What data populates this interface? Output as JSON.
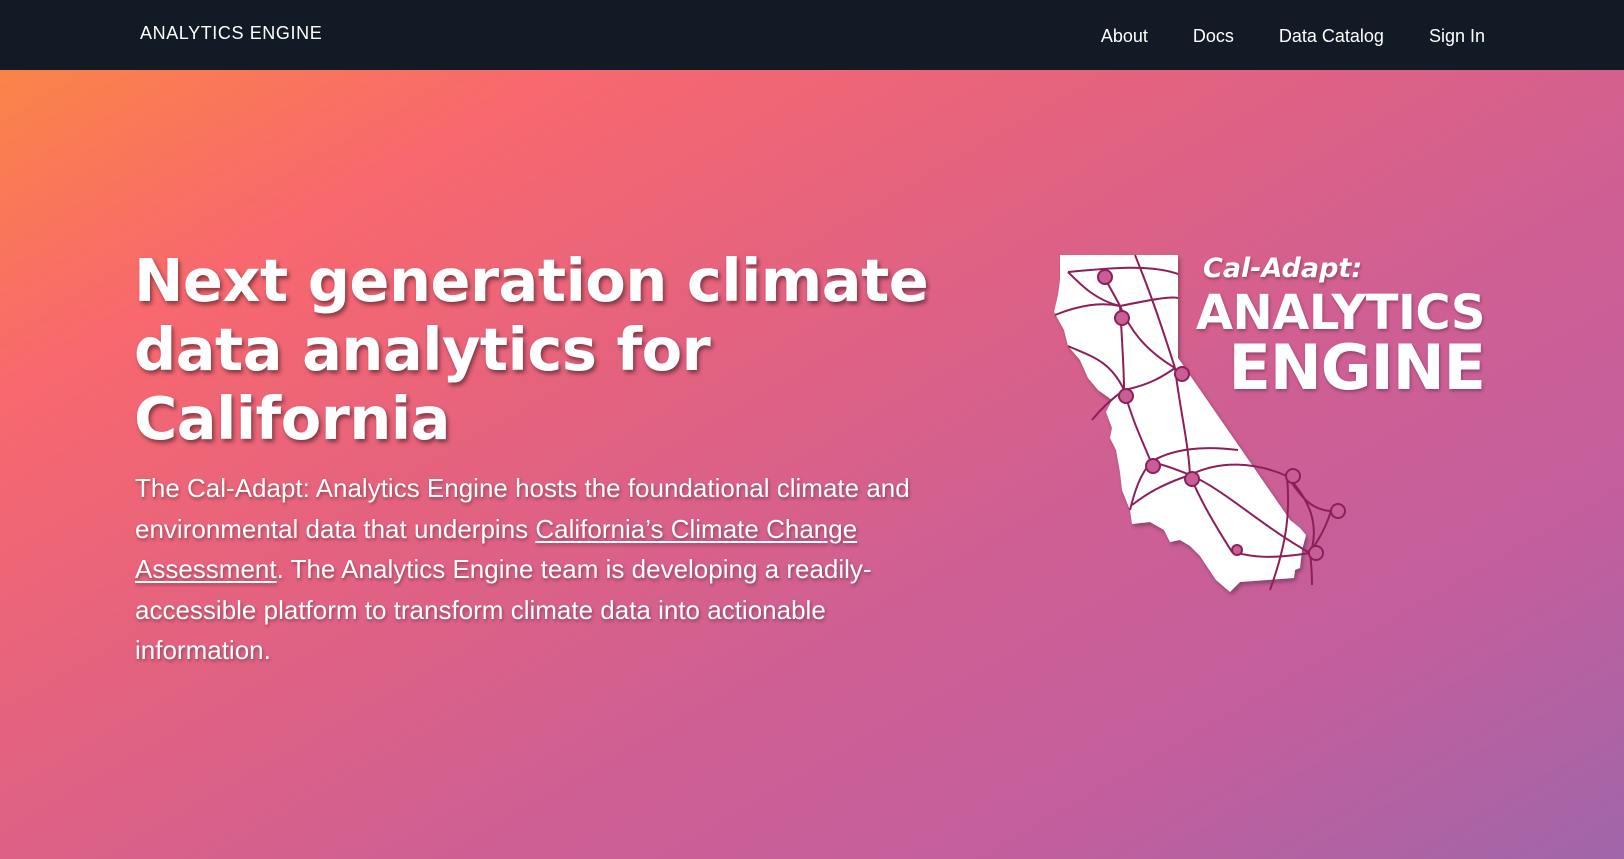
{
  "nav": {
    "brand": "ANALYTICS ENGINE",
    "links": [
      "About",
      "Docs",
      "Data Catalog",
      "Sign In"
    ]
  },
  "hero": {
    "title": "Next generation climate data analytics for California",
    "text_before_link": "The Cal-Adapt: Analytics Engine hosts the foundational climate and environmental data that underpins ",
    "link_text": "California’s Climate Change Assessment",
    "text_after_link": ". The Analytics Engine team is developing a readily-accessible platform to transform climate data into actionable information."
  },
  "logo": {
    "subtitle": "Cal-Adapt:",
    "line1": "ANALYTICS",
    "line2": "ENGINE"
  },
  "colors": {
    "navbar": "#121a26",
    "gradient_start": "#fb8a3f",
    "gradient_mid": "#f8686e",
    "gradient_end": "#a066a9",
    "network_line": "#8c1f5a"
  }
}
